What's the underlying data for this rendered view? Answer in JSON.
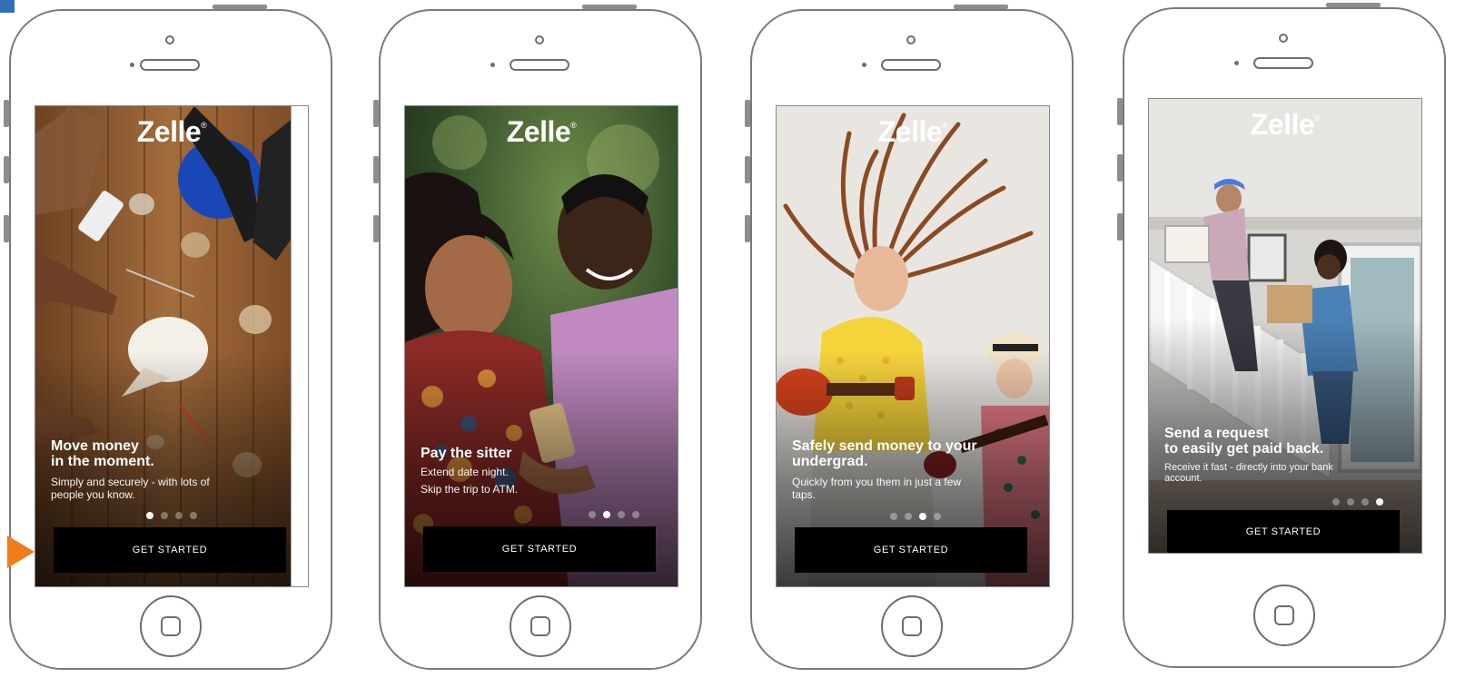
{
  "brand": {
    "logo_text": "Zelle",
    "trademark": "®"
  },
  "colors": {
    "button_bg": "#000000",
    "pointer": "#f07c1a",
    "active_dot": "#ffffff"
  },
  "screens": [
    {
      "headline": "Move money\nin the moment.",
      "subtext": "Simply and securely - with lots of\npeople you know.",
      "cta": "GET STARTED",
      "active_dot": 1,
      "dot_count": 4
    },
    {
      "headline": "Pay the sitter",
      "subtext": "Extend date night.\nSkip the trip to ATM.",
      "cta": "GET STARTED",
      "active_dot": 2,
      "dot_count": 4
    },
    {
      "headline": "Safely send money to your\nundergrad.",
      "subtext": "Quickly from you them in just a few\ntaps.",
      "cta": "GET STARTED",
      "active_dot": 3,
      "dot_count": 4
    },
    {
      "headline": "Send a request\nto easily get paid back.",
      "subtext": "Receive it fast - directly into your bank\naccount.",
      "cta": "GET STARTED",
      "active_dot": 4,
      "dot_count": 4
    }
  ],
  "icons": {
    "pointer": "current-screen-arrow-icon",
    "home": "home-button-icon"
  }
}
